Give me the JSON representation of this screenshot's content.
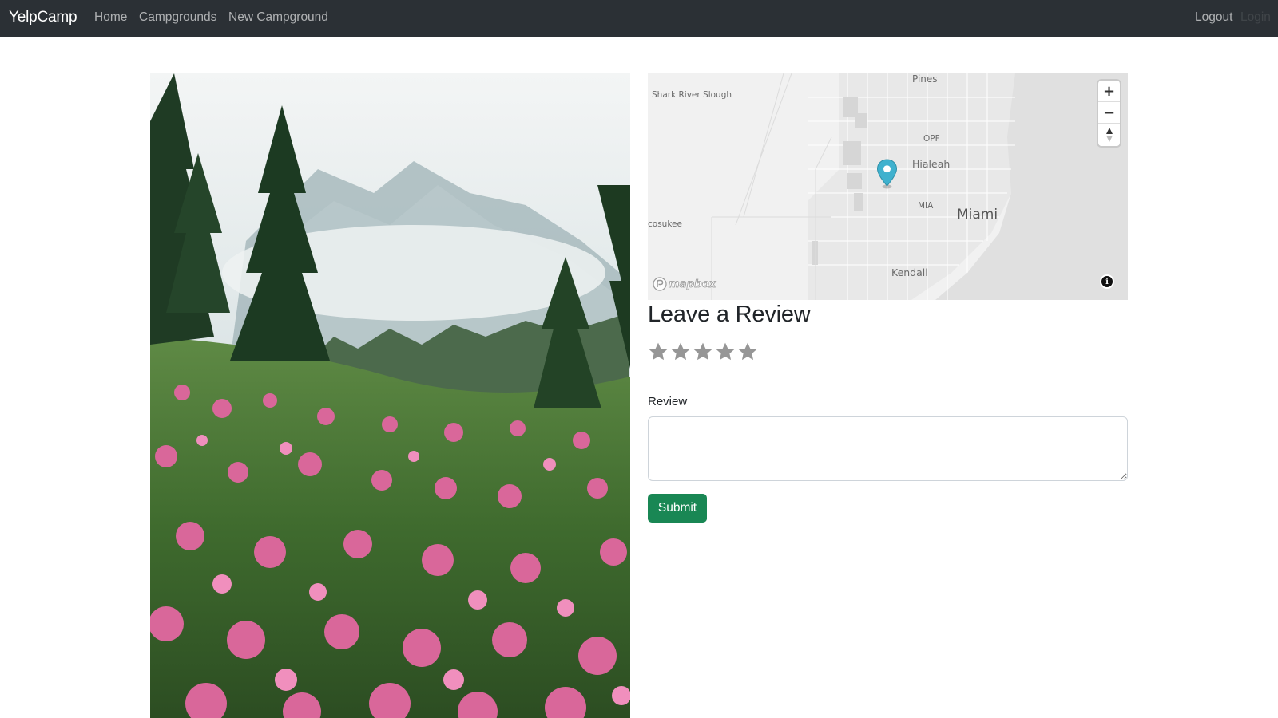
{
  "navbar": {
    "brand": "YelpCamp",
    "links": [
      "Home",
      "Campgrounds",
      "New Campground"
    ],
    "logout": "Logout",
    "login": "Login"
  },
  "photo": {
    "description_icon": "campground-photo"
  },
  "map": {
    "labels": {
      "pines": "Pines",
      "shark": "Shark River Slough",
      "opf": "OPF",
      "hialeah": "Hialeah",
      "mia": "MIA",
      "miami": "Miami",
      "cosukee": "cosukee",
      "kendall": "Kendall"
    },
    "zoom_in": "+",
    "zoom_out": "−",
    "logo": "mapbox",
    "pin_color": "#3fb1ce",
    "water_color": "#e0e0e0"
  },
  "review": {
    "title": "Leave a Review",
    "rating_stars": 5,
    "rating_value": 0,
    "star_color": "#969696",
    "label": "Review",
    "textarea_value": "",
    "submit": "Submit",
    "submit_color": "#198754"
  }
}
